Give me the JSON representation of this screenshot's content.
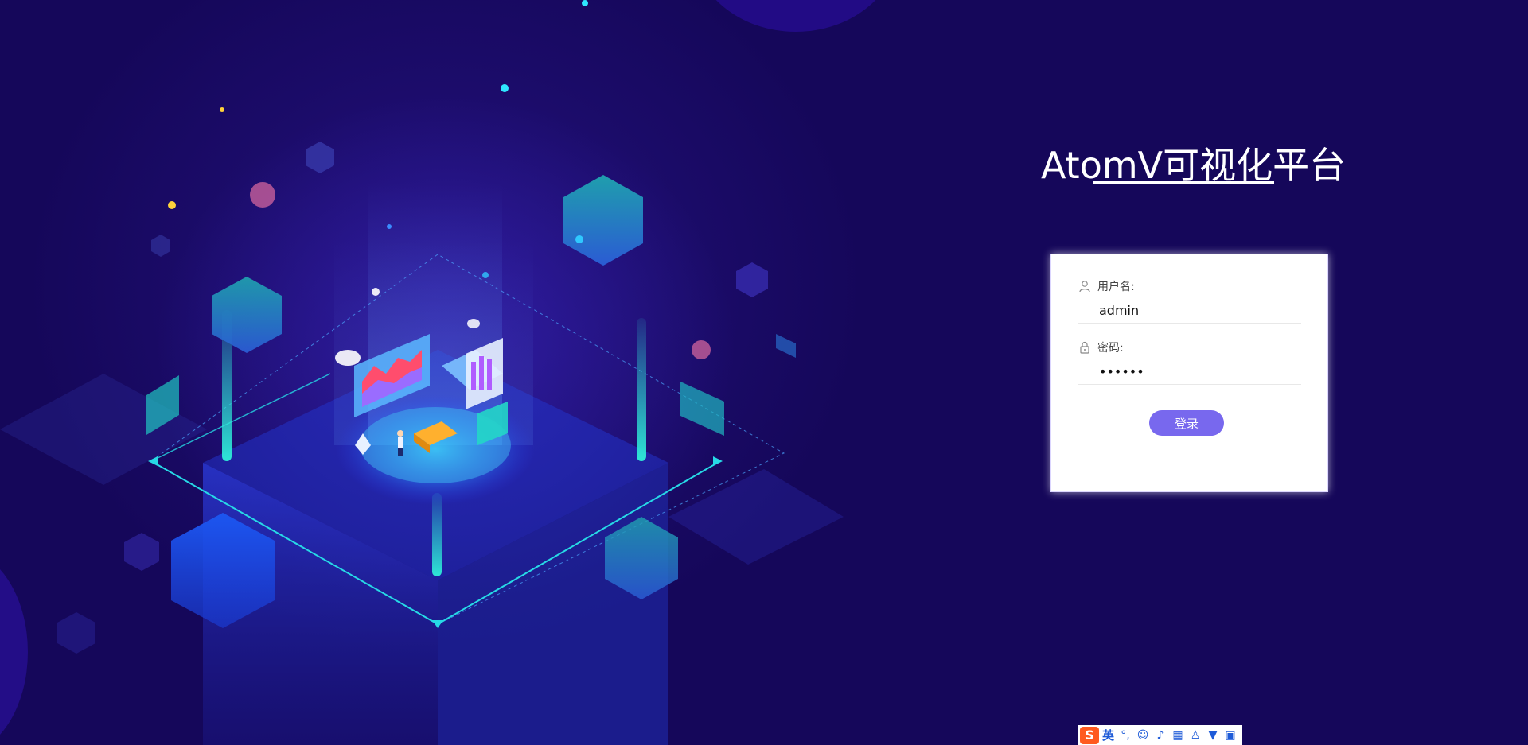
{
  "app": {
    "title": "AtomV可视化平台"
  },
  "login": {
    "username_label": "用户名:",
    "username_value": "admin",
    "password_label": "密码:",
    "password_value": "••••••",
    "submit_label": "登录"
  },
  "ime": {
    "logo": "S",
    "lang": "英",
    "icons": [
      "punctuation-icon",
      "emoji-icon",
      "microphone-icon",
      "keyboard-icon",
      "user-icon",
      "skin-icon",
      "grid-icon"
    ]
  },
  "colors": {
    "background": "#15075a",
    "button": "#7868ee",
    "accent_cyan": "#22e0e0"
  }
}
